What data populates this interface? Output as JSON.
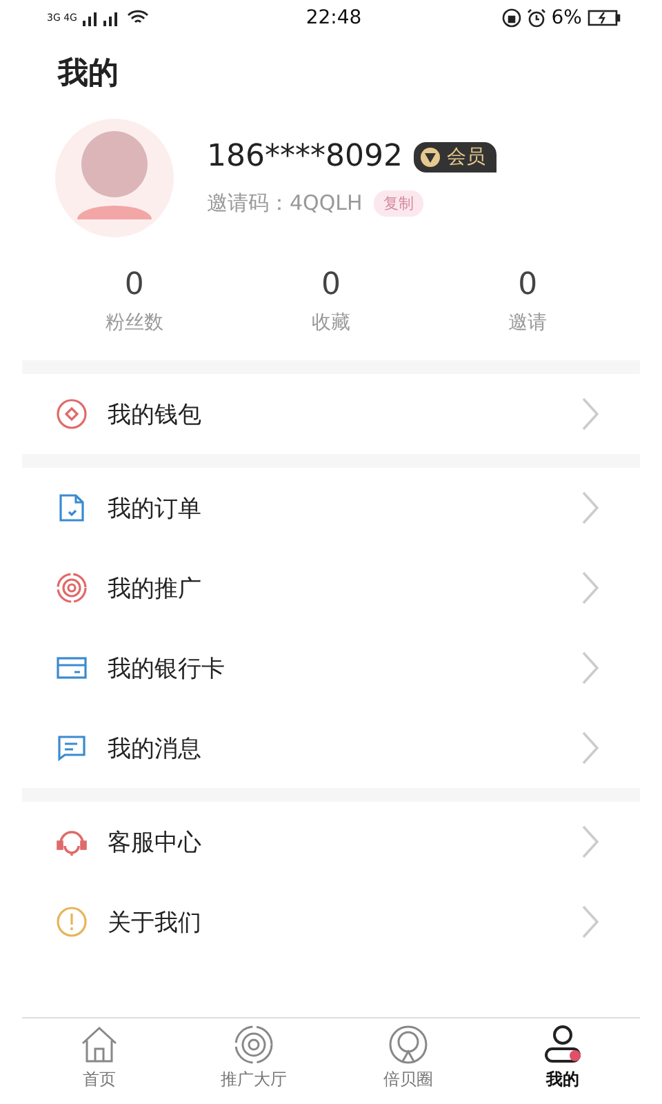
{
  "status_bar": {
    "network": "3G 4G",
    "time": "22:48",
    "battery": "6%"
  },
  "title": "我的",
  "profile": {
    "phone": "186****8092",
    "badge": "会员",
    "invite_label": "邀请码：4QQLH",
    "copy_button": "复制"
  },
  "stats": [
    {
      "value": "0",
      "label": "粉丝数"
    },
    {
      "value": "0",
      "label": "收藏"
    },
    {
      "value": "0",
      "label": "邀请"
    }
  ],
  "menu_groups": [
    [
      {
        "kind": "wallet",
        "label": "我的钱包"
      }
    ],
    [
      {
        "kind": "order",
        "label": "我的订单"
      },
      {
        "kind": "promo",
        "label": "我的推广"
      },
      {
        "kind": "card",
        "label": "我的银行卡"
      },
      {
        "kind": "message",
        "label": "我的消息"
      }
    ],
    [
      {
        "kind": "service",
        "label": "客服中心"
      },
      {
        "kind": "about",
        "label": "关于我们"
      }
    ]
  ],
  "tabs": [
    {
      "kind": "home",
      "label": "首页",
      "selected": false
    },
    {
      "kind": "hall",
      "label": "推广大厅",
      "selected": false
    },
    {
      "kind": "circle",
      "label": "倍贝圈",
      "selected": false
    },
    {
      "kind": "me",
      "label": "我的",
      "selected": true
    }
  ]
}
